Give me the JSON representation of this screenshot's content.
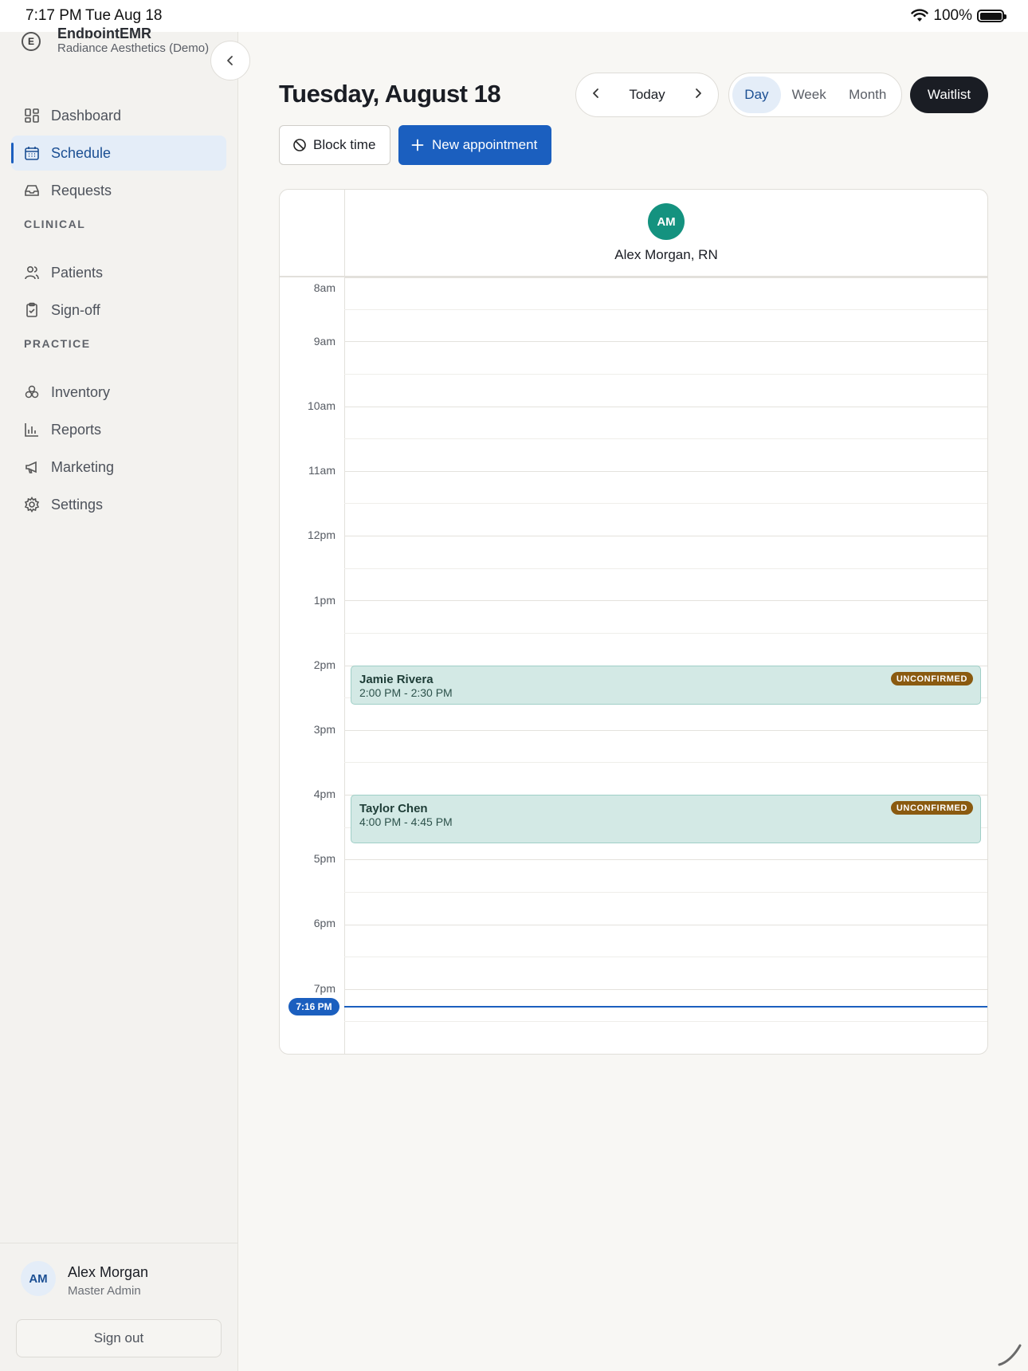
{
  "status_bar": {
    "time": "7:17 PM",
    "date": "Tue Aug 18",
    "battery": "100%"
  },
  "sidebar": {
    "brand_name": "EndpointEMR",
    "brand_sub": "Radiance Aesthetics (Demo)",
    "logo_letter": "E",
    "items": [
      {
        "label": "Dashboard",
        "icon": "dashboard-icon"
      },
      {
        "label": "Schedule",
        "icon": "calendar-icon",
        "active": true
      },
      {
        "label": "Requests",
        "icon": "inbox-icon"
      }
    ],
    "clinical_label": "CLINICAL",
    "clinical_items": [
      {
        "label": "Patients",
        "icon": "users-icon"
      },
      {
        "label": "Sign-off",
        "icon": "clipboard-check-icon"
      }
    ],
    "practice_label": "PRACTICE",
    "practice_items": [
      {
        "label": "Inventory",
        "icon": "boxes-icon"
      },
      {
        "label": "Reports",
        "icon": "bar-chart-icon"
      },
      {
        "label": "Marketing",
        "icon": "megaphone-icon"
      },
      {
        "label": "Settings",
        "icon": "gear-icon"
      }
    ],
    "user": {
      "initials": "AM",
      "name": "Alex Morgan",
      "role": "Master Admin"
    },
    "sign_out": "Sign out"
  },
  "header": {
    "title": "Tuesday, August 18",
    "today": "Today",
    "views": [
      "Day",
      "Week",
      "Month"
    ],
    "active_view": "Day",
    "waitlist": "Waitlist",
    "block_time": "Block time",
    "new_appointment": "New appointment"
  },
  "calendar": {
    "provider": {
      "initials": "AM",
      "name": "Alex Morgan, RN"
    },
    "hours": [
      "8am",
      "9am",
      "10am",
      "11am",
      "12pm",
      "1pm",
      "2pm",
      "3pm",
      "4pm",
      "5pm",
      "6pm",
      "7pm"
    ],
    "appointments": [
      {
        "name": "Jamie Rivera",
        "time": "2:00 PM - 2:30 PM",
        "status": "UNCONFIRMED"
      },
      {
        "name": "Taylor Chen",
        "time": "4:00 PM - 4:45 PM",
        "status": "UNCONFIRMED"
      }
    ],
    "now_label": "7:16 PM"
  },
  "colors": {
    "primary": "#1b5fbf",
    "appointment_bg": "#d3e9e5",
    "badge": "#8a5a10",
    "provider_avatar": "#14927f",
    "dark_button": "#1a1d24"
  }
}
